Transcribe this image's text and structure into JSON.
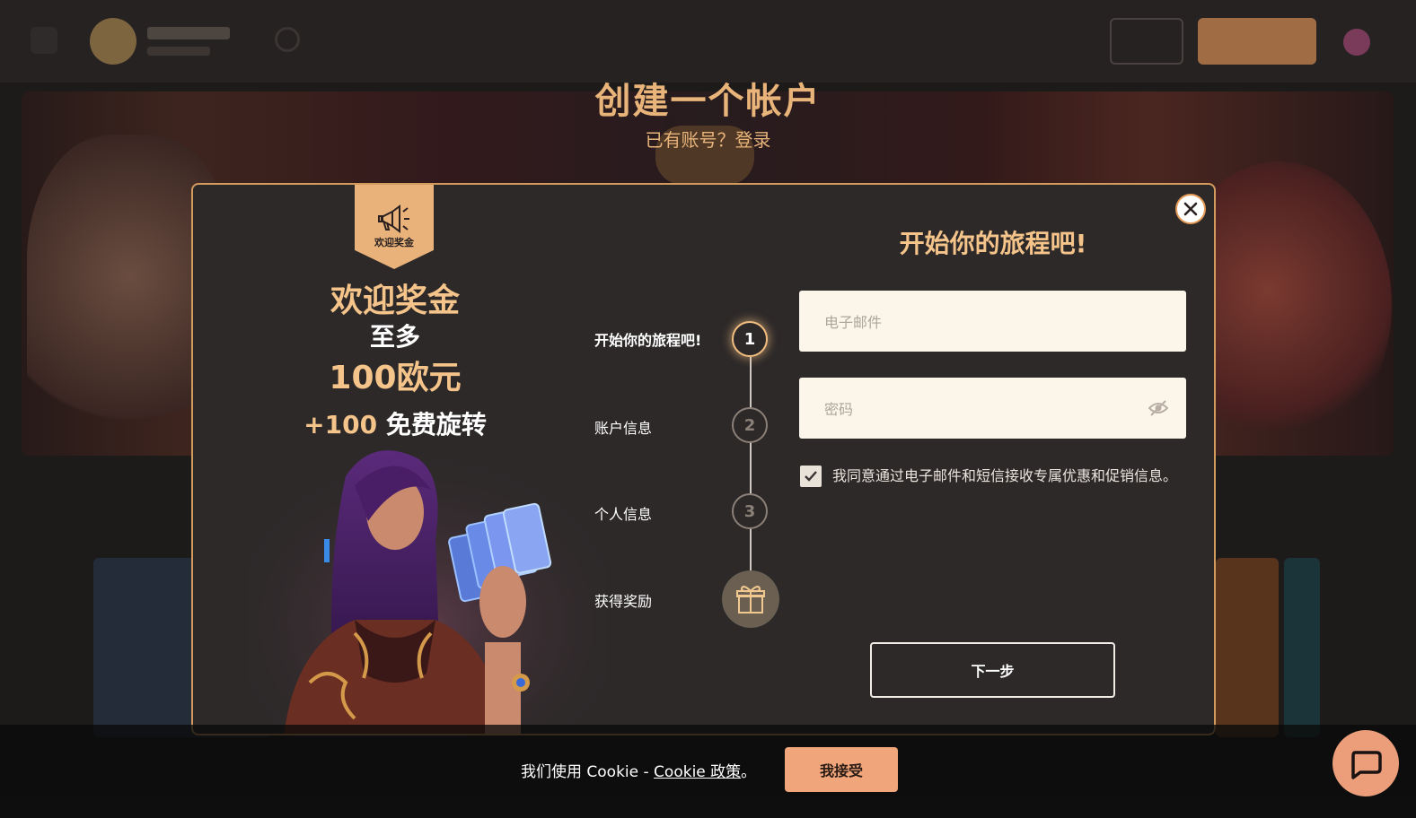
{
  "page": {
    "title": "创建一个帐户",
    "subtitle": "已有账号？登录"
  },
  "modal": {
    "promo": {
      "ribbon_label": "欢迎奖金",
      "title": "欢迎奖金",
      "line2": "至多",
      "amount": "100欧元",
      "spins_plus": "+100",
      "spins_text": " 免费旋转"
    },
    "steps": [
      {
        "label": "开始你的旅程吧!",
        "number": "1",
        "active": true
      },
      {
        "label": "账户信息",
        "number": "2",
        "active": false
      },
      {
        "label": "个人信息",
        "number": "3",
        "active": false
      },
      {
        "label": "获得奖励",
        "icon": "gift-icon",
        "active": false
      }
    ],
    "form": {
      "title": "开始你的旅程吧!",
      "email_placeholder": "电子邮件",
      "email_value": "",
      "password_placeholder": "密码",
      "password_value": "",
      "consent_checked": true,
      "consent_text": "我同意通过电子邮件和短信接收专属优惠和促销信息。",
      "next_label": "下一步"
    }
  },
  "cookie": {
    "text": "我们使用 Cookie - ",
    "link_label": "Cookie 政策",
    "suffix": "。",
    "accept_label": "我接受"
  },
  "colors": {
    "accent": "#f5c48a",
    "modal_bg": "#2d2929",
    "border": "#d39a5d",
    "cookie_button": "#f0a67a",
    "chat_button": "#ec9e7a"
  },
  "icons": [
    "megaphone-icon",
    "gift-icon",
    "close-icon",
    "eye-slash-icon",
    "check-icon",
    "chat-icon"
  ]
}
